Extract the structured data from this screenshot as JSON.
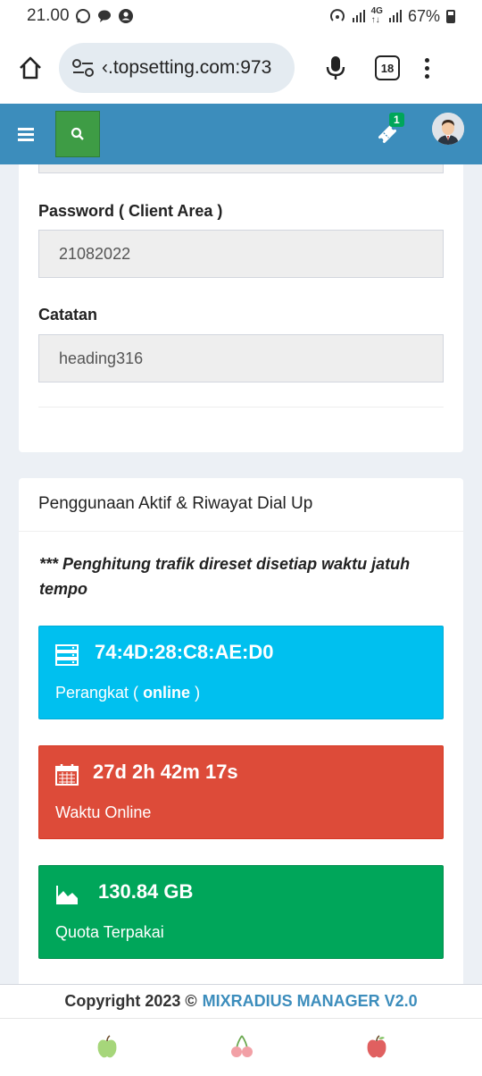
{
  "status_bar": {
    "time": "21.00",
    "battery": "67%"
  },
  "browser": {
    "url": "‹.topsetting.com:973",
    "tab_count": "18"
  },
  "header": {
    "notification_count": "1"
  },
  "form": {
    "password_label": "Password ( Client Area )",
    "password_value": "21082022",
    "note_label": "Catatan",
    "note_value": "heading316"
  },
  "usage": {
    "title": "Penggunaan Aktif & Riwayat Dial Up",
    "note": "*** Penghitung trafik direset disetiap waktu jatuh tempo",
    "device": {
      "value": "74:4D:28:C8:AE:D0",
      "label_prefix": "Perangkat ( ",
      "status": "online",
      "label_suffix": " )"
    },
    "online_time": {
      "value": "27d 2h 42m 17s",
      "label": "Waktu Online"
    },
    "quota": {
      "value": "130.84 GB",
      "label": "Quota Terpakai"
    }
  },
  "footer": {
    "copyright": "Copyright 2023 ©",
    "brand": "MIXRADIUS MANAGER V2.0"
  },
  "colors": {
    "header": "#3c8dbc",
    "aqua": "#00c0ef",
    "red": "#dd4b39",
    "green": "#00a65a"
  }
}
